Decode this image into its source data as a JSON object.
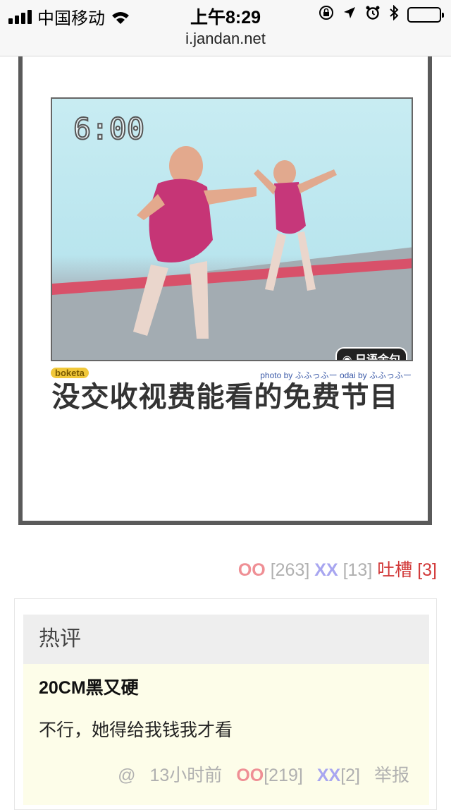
{
  "status_bar": {
    "carrier": "中国移动",
    "time": "上午8:29"
  },
  "url_bar": {
    "url": "i.jandan.net"
  },
  "post": {
    "image": {
      "timestamp_overlay": "6:00",
      "watermark_left": "boketa",
      "credit_text": "photo by ふふっふー   odai by ふふっふー",
      "wechat_tag": "日语金句",
      "caption": "没交收视费能看的免费节目"
    },
    "votes": {
      "oo_label": "OO",
      "oo_count": "[263]",
      "xx_label": "XX",
      "xx_count": "[13]",
      "tucao_label": "吐槽",
      "tucao_count": "[3]"
    }
  },
  "hot_comments": {
    "title": "热评",
    "items": [
      {
        "author": "20CM黑又硬",
        "text": "不行，她得给我钱我才看",
        "at": "@",
        "time": "13小时前",
        "oo_label": "OO",
        "oo_count": "[219]",
        "xx_label": "XX",
        "xx_count": "[2]",
        "report": "举报"
      }
    ]
  }
}
